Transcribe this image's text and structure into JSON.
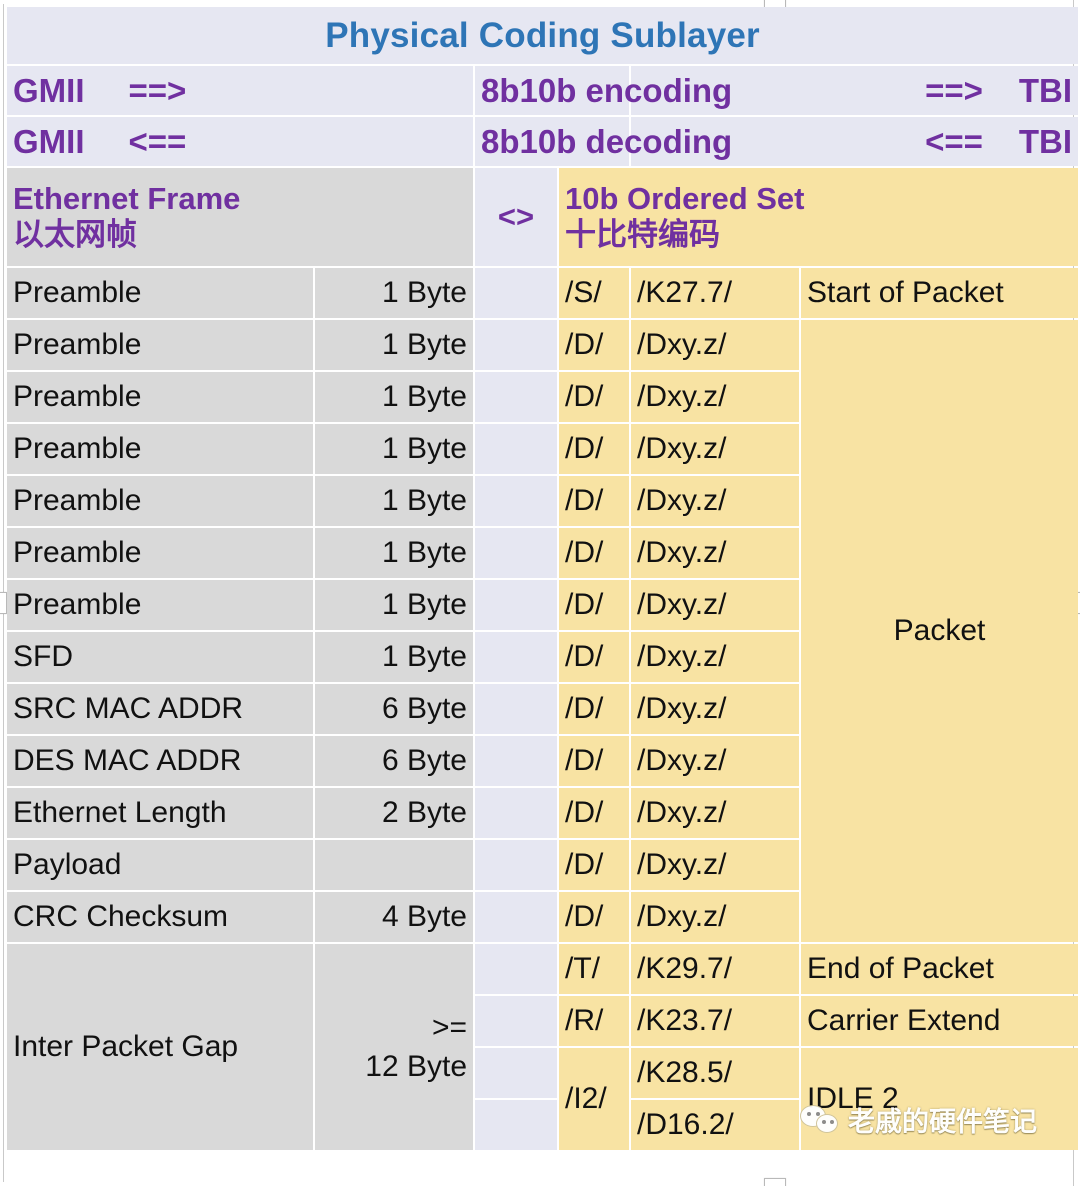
{
  "title": "Physical Coding Sublayer",
  "flow": {
    "encode": {
      "left": "GMII",
      "left_arrow": "==>",
      "middle": "8b10b encoding",
      "right_arrow": "==>",
      "right": "TBI"
    },
    "decode": {
      "left": "GMII",
      "left_arrow": "<==",
      "middle": "8b10b decoding",
      "right_arrow": "<==",
      "right": "TBI"
    }
  },
  "headers": {
    "left_en": "Ethernet Frame",
    "left_zh": "以太网帧",
    "middle": "<>",
    "right_en": "10b Ordered Set",
    "right_zh": "十比特编码"
  },
  "rows": [
    {
      "name": "Preamble",
      "size": "1 Byte",
      "code": "/S/",
      "code2": "/K27.7/",
      "meaning": "Start of Packet"
    },
    {
      "name": "Preamble",
      "size": "1 Byte",
      "code": "/D/",
      "code2": "/Dxy.z/",
      "meaning": ""
    },
    {
      "name": "Preamble",
      "size": "1 Byte",
      "code": "/D/",
      "code2": "/Dxy.z/",
      "meaning": ""
    },
    {
      "name": "Preamble",
      "size": "1 Byte",
      "code": "/D/",
      "code2": "/Dxy.z/",
      "meaning": ""
    },
    {
      "name": "Preamble",
      "size": "1 Byte",
      "code": "/D/",
      "code2": "/Dxy.z/",
      "meaning": ""
    },
    {
      "name": "Preamble",
      "size": "1 Byte",
      "code": "/D/",
      "code2": "/Dxy.z/",
      "meaning": ""
    },
    {
      "name": "Preamble",
      "size": "1 Byte",
      "code": "/D/",
      "code2": "/Dxy.z/",
      "meaning": ""
    },
    {
      "name": "SFD",
      "size": "1 Byte",
      "code": "/D/",
      "code2": "/Dxy.z/",
      "meaning": ""
    },
    {
      "name": "SRC MAC ADDR",
      "size": "6 Byte",
      "code": "/D/",
      "code2": "/Dxy.z/",
      "meaning": ""
    },
    {
      "name": "DES MAC ADDR",
      "size": "6 Byte",
      "code": "/D/",
      "code2": "/Dxy.z/",
      "meaning": ""
    },
    {
      "name": "Ethernet Length",
      "size": "2 Byte",
      "code": "/D/",
      "code2": "/Dxy.z/",
      "meaning": ""
    },
    {
      "name": "Payload",
      "size": "",
      "code": "/D/",
      "code2": "/Dxy.z/",
      "meaning": ""
    },
    {
      "name": "CRC Checksum",
      "size": "4 Byte",
      "code": "/D/",
      "code2": "/Dxy.z/",
      "meaning": ""
    }
  ],
  "packet_label": "Packet",
  "ipg": {
    "name": "Inter Packet Gap",
    "size_line1": ">=",
    "size_line2": "12 Byte",
    "rows": [
      {
        "code": "/T/",
        "code2": "/K29.7/",
        "meaning": "End of Packet"
      },
      {
        "code": "/R/",
        "code2": "/K23.7/",
        "meaning": "Carrier Extend"
      }
    ],
    "idle": {
      "code": "/I2/",
      "code2_a": "/K28.5/",
      "code2_b": "/D16.2/",
      "meaning": "IDLE 2"
    }
  },
  "watermark": {
    "text": "老戚的硬件笔记",
    "icon": "wechat-icon"
  },
  "colors": {
    "title_blue": "#2E75B6",
    "purple": "#7030A0",
    "lavender": "#E6E7F2",
    "gray": "#D9D9D9",
    "yellow": "#F8E3A3"
  }
}
